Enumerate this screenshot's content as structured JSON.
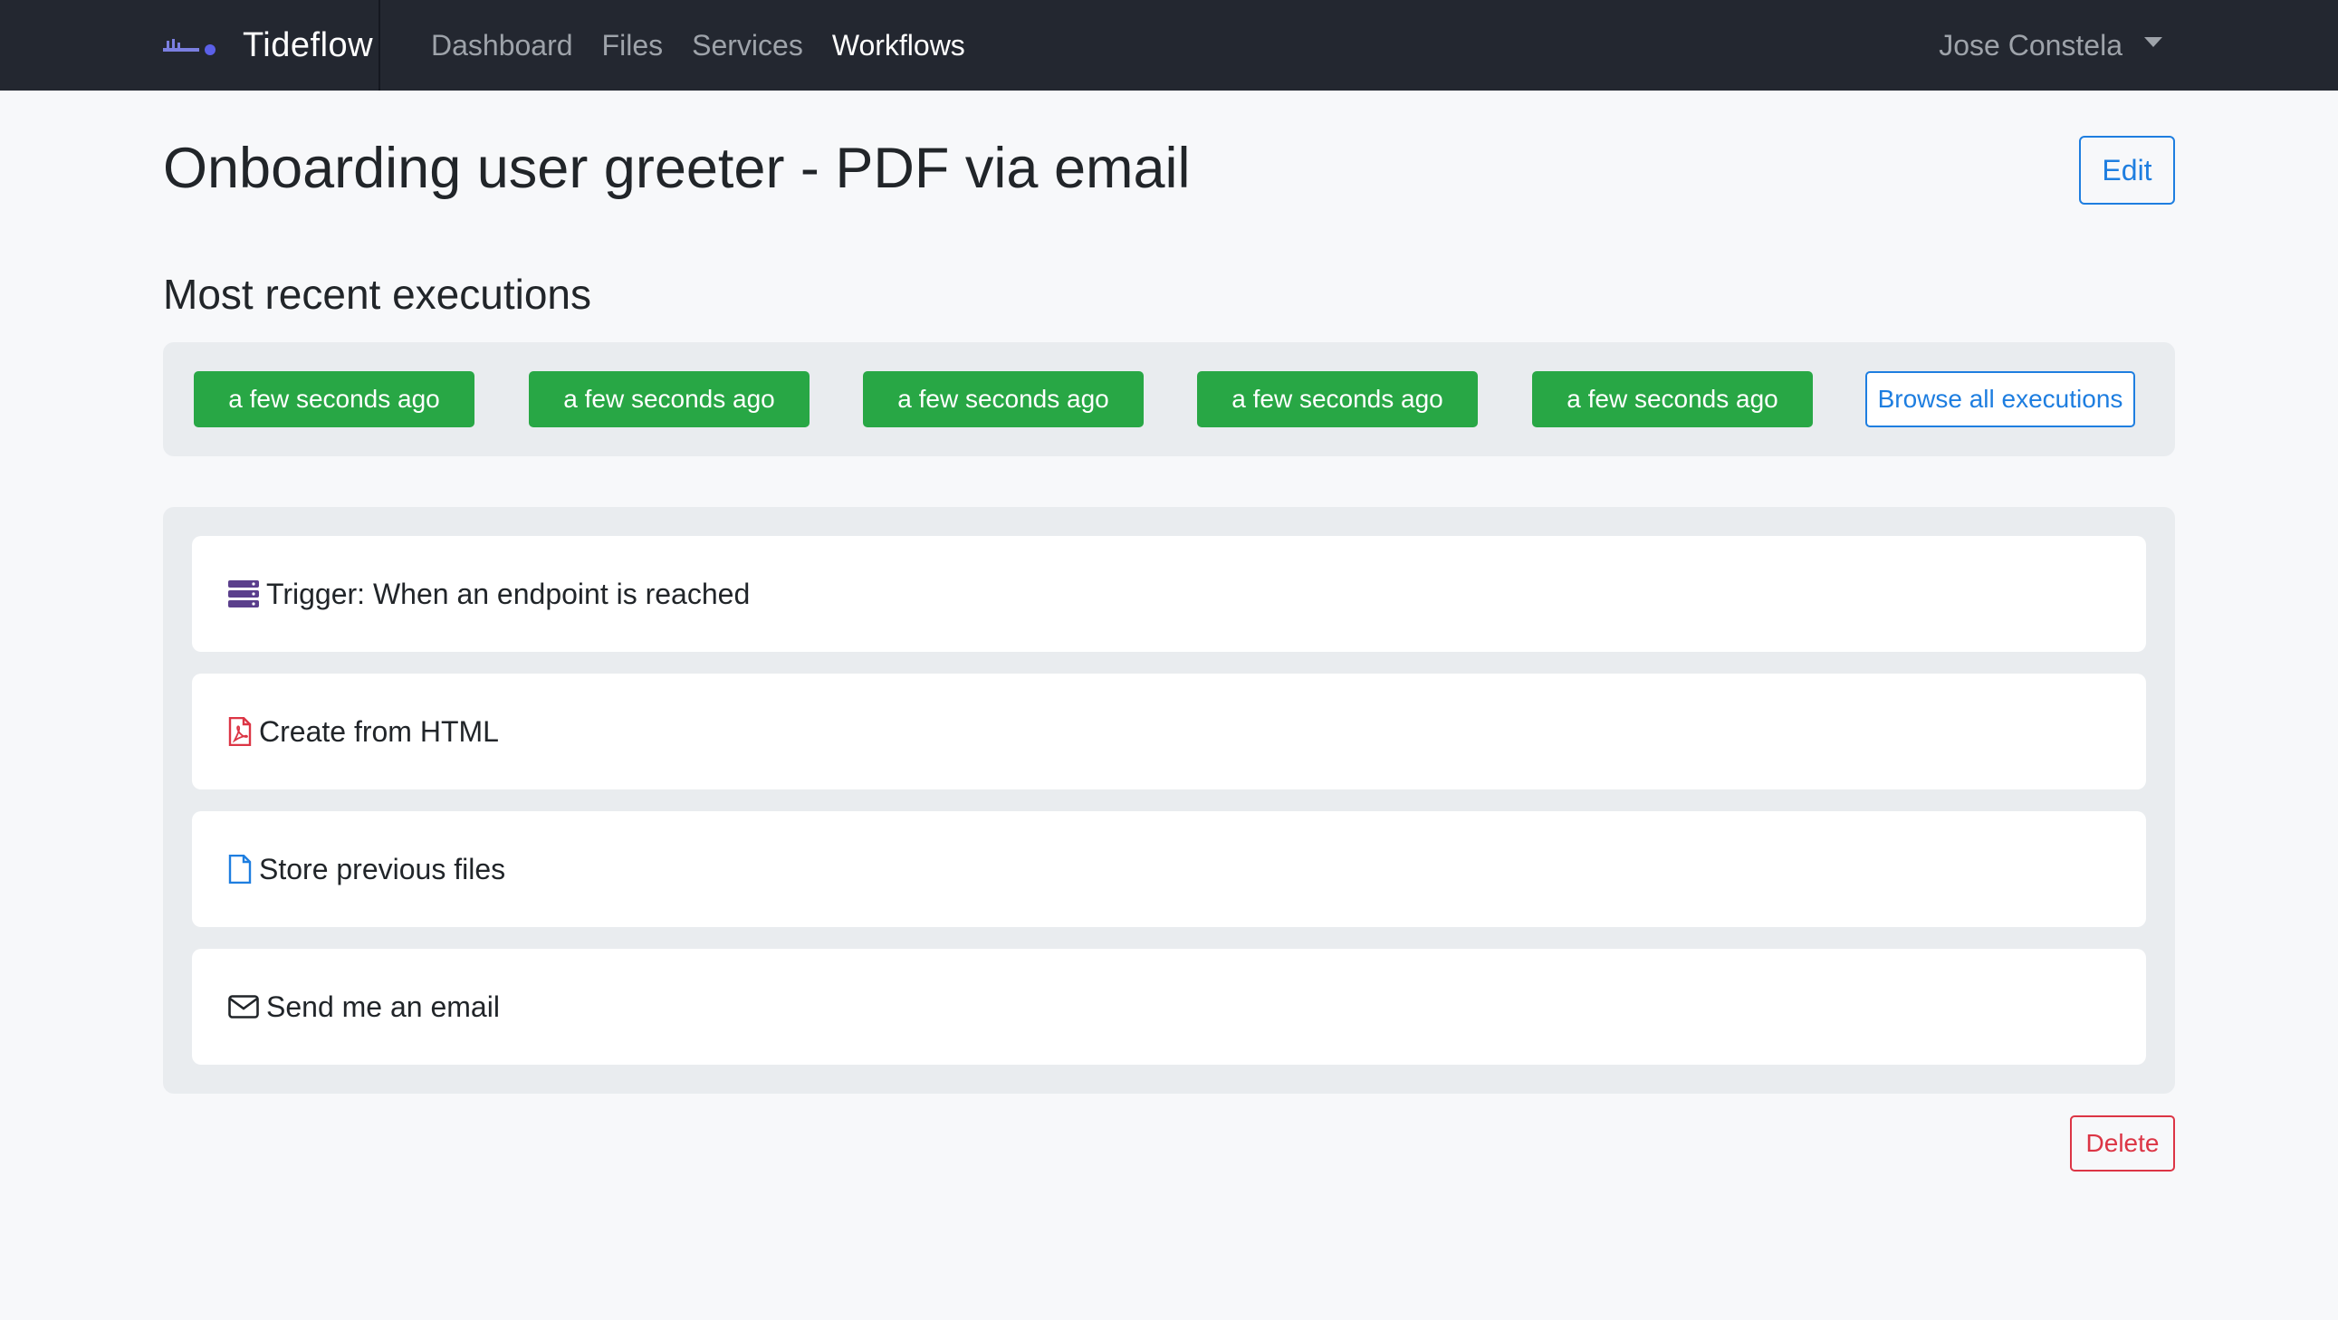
{
  "navbar": {
    "brand": "Tideflow",
    "links": [
      "Dashboard",
      "Files",
      "Services",
      "Workflows"
    ],
    "active_link": "Workflows",
    "user": "Jose Constela"
  },
  "page": {
    "title": "Onboarding user greeter - PDF via email",
    "edit_label": "Edit",
    "delete_label": "Delete"
  },
  "executions": {
    "title": "Most recent executions",
    "items": [
      "a few seconds ago",
      "a few seconds ago",
      "a few seconds ago",
      "a few seconds ago",
      "a few seconds ago"
    ],
    "browse_label": "Browse all executions"
  },
  "steps": [
    {
      "label": "Trigger: When an endpoint is reached",
      "icon": "server-icon",
      "color": "#5b3f8c"
    },
    {
      "label": "Create from HTML",
      "icon": "file-pdf-icon",
      "color": "#dc3545"
    },
    {
      "label": "Store previous files",
      "icon": "file-icon",
      "color": "#1e7ee0"
    },
    {
      "label": "Send me an email",
      "icon": "envelope-icon",
      "color": "#212529"
    }
  ],
  "colors": {
    "navbar": "#232730",
    "success": "#28a745",
    "primary": "#1e7ee0",
    "danger": "#dc3545",
    "panel": "#e9ecef"
  }
}
